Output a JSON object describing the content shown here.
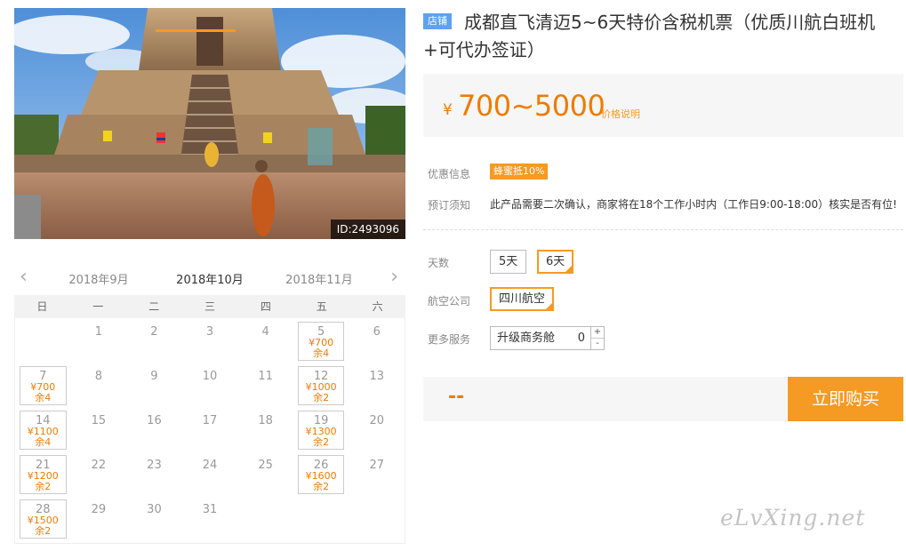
{
  "photo": {
    "id_label": "ID:2493096"
  },
  "calendar": {
    "prev_month": "2018年9月",
    "current_month": "2018年10月",
    "next_month": "2018年11月",
    "weekdays": [
      "日",
      "一",
      "二",
      "三",
      "四",
      "五",
      "六"
    ],
    "weeks": [
      [
        {
          "day": ""
        },
        {
          "day": "1"
        },
        {
          "day": "2"
        },
        {
          "day": "3"
        },
        {
          "day": "4"
        },
        {
          "day": "5",
          "price": "¥700",
          "remain": "余4"
        },
        {
          "day": "6"
        }
      ],
      [
        {
          "day": "7",
          "price": "¥700",
          "remain": "余4"
        },
        {
          "day": "8"
        },
        {
          "day": "9"
        },
        {
          "day": "10"
        },
        {
          "day": "11"
        },
        {
          "day": "12",
          "price": "¥1000",
          "remain": "余2"
        },
        {
          "day": "13"
        }
      ],
      [
        {
          "day": "14",
          "price": "¥1100",
          "remain": "余4"
        },
        {
          "day": "15"
        },
        {
          "day": "16"
        },
        {
          "day": "17"
        },
        {
          "day": "18"
        },
        {
          "day": "19",
          "price": "¥1300",
          "remain": "余2"
        },
        {
          "day": "20"
        }
      ],
      [
        {
          "day": "21",
          "price": "¥1200",
          "remain": "余2"
        },
        {
          "day": "22"
        },
        {
          "day": "23"
        },
        {
          "day": "24"
        },
        {
          "day": "25"
        },
        {
          "day": "26",
          "price": "¥1600",
          "remain": "余2"
        },
        {
          "day": "27"
        }
      ],
      [
        {
          "day": "28",
          "price": "¥1500",
          "remain": "余2"
        },
        {
          "day": "29"
        },
        {
          "day": "30"
        },
        {
          "day": "31"
        },
        {
          "day": ""
        },
        {
          "day": ""
        },
        {
          "day": ""
        }
      ]
    ]
  },
  "product": {
    "shop_tag": "店铺",
    "title": "成都直飞清迈5~6天特价含税机票（优质川航白班机+可代办签证）",
    "price_symbol": "¥",
    "price_range": "700~5000",
    "price_note": "价格说明",
    "discount_label": "优惠信息",
    "discount_badge": "蜂蜜抵10%",
    "notice_label": "预订须知",
    "notice_text": "此产品需要二次确认，商家将在18个工作小时内（工作日9:00-18:00）核实是否有位!",
    "days_label": "天数",
    "days_options": [
      "5天",
      "6天"
    ],
    "days_selected": "6天",
    "airline_label": "航空公司",
    "airline_selected": "四川航空",
    "service_label": "更多服务",
    "service_name": "升级商务舱",
    "service_qty": "0",
    "stepper_plus": "+",
    "stepper_minus": "-",
    "total": "--",
    "buy_label": "立即购买"
  },
  "watermark": "eLvXing.net",
  "colors": {
    "accent": "#f59a23",
    "price": "#f07b00",
    "tag": "#5ea1f0"
  }
}
